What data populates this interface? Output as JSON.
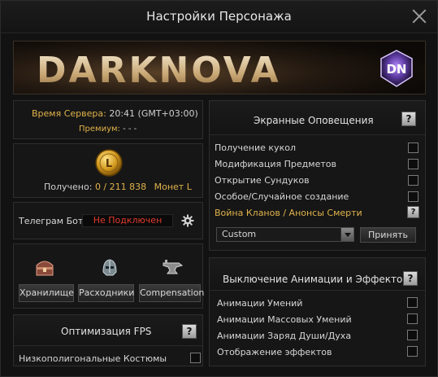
{
  "window": {
    "title": "Настройки Персонажа"
  },
  "banner": {
    "brand": "DARKNOVA",
    "logo_text": "DN"
  },
  "server": {
    "time_label": "Время Сервера:",
    "time_value": "20:41 (GMT+03:00)",
    "premium_label": "Премиум:",
    "premium_value": "- - -"
  },
  "coins": {
    "icon": "coin-l-icon",
    "received_label": "Получено:",
    "received_value": "0 / 211 838",
    "currency": "Монет L"
  },
  "telegram": {
    "label": "Телеграм Бот",
    "status": "Не Подключен",
    "settings_icon": "gear-icon"
  },
  "shortcuts": [
    {
      "label": "Хранилище",
      "icon": "chest-icon"
    },
    {
      "label": "Расходники",
      "icon": "helmet-icon"
    },
    {
      "label": "Compensation",
      "icon": "anvil-icon"
    }
  ],
  "fps": {
    "title": "Оптимизация FPS",
    "help": "?",
    "items": [
      {
        "label": "Низкополигональные Костюмы",
        "checked": false
      }
    ]
  },
  "notifications": {
    "title": "Экранные Оповещения",
    "help": "?",
    "items": [
      {
        "label": "Получение кукол",
        "checked": false
      },
      {
        "label": "Модификация Предметов",
        "checked": false
      },
      {
        "label": "Открытие Сундуков",
        "checked": false
      },
      {
        "label": "Особое/Случайное создание",
        "checked": false
      }
    ],
    "clan_war_label": "Война Кланов / Анонсы Смерти",
    "clan_war_help": "?",
    "select_value": "Custom",
    "apply_label": "Принять"
  },
  "animations": {
    "title": "Выключение Анимации и Эффектов",
    "help": "?",
    "items": [
      {
        "label": "Анимации Умений",
        "checked": false
      },
      {
        "label": "Анимации Массовых Умений",
        "checked": false
      },
      {
        "label": "Анимации Заряд Души/Духа",
        "checked": false
      },
      {
        "label": "Отображение эффектов",
        "checked": false
      }
    ]
  }
}
